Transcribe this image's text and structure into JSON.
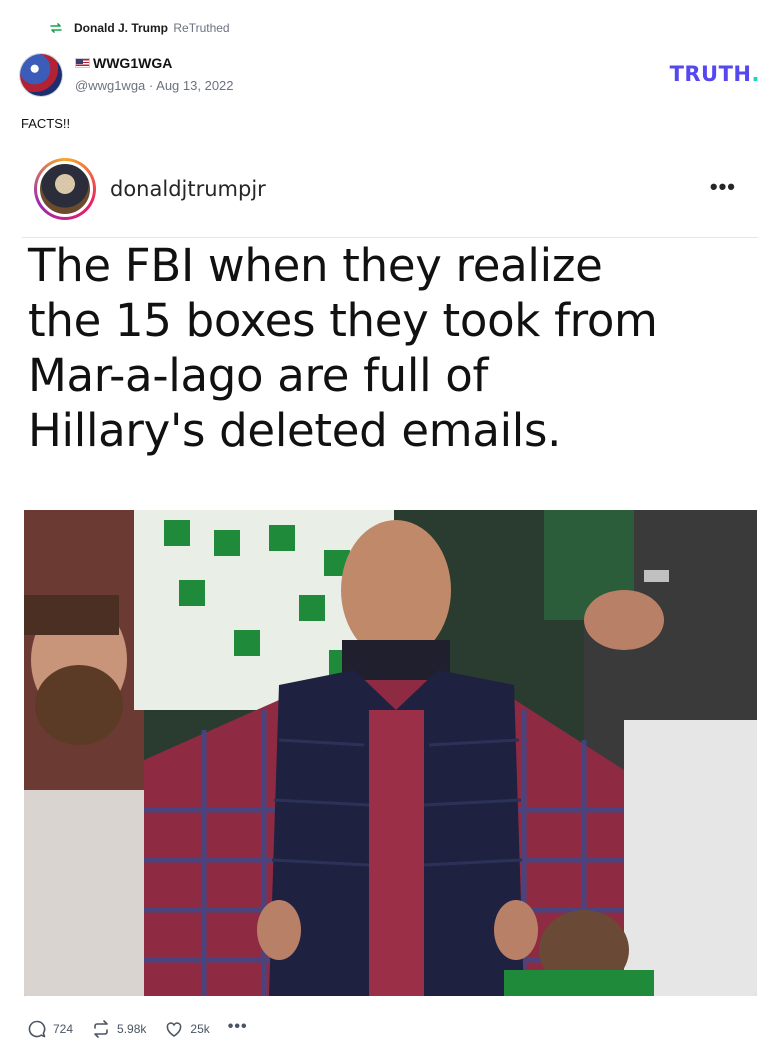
{
  "retruth": {
    "user": "Donald J. Trump",
    "label": "ReTruthed",
    "icon": "retruth-icon"
  },
  "post": {
    "display_name": "WWG1WGA",
    "name_prefix_icon": "us-flag-icon",
    "handle": "@wwg1wga",
    "separator": "·",
    "date": "Aug 13, 2022",
    "text": "FACTS!!"
  },
  "brand": {
    "name": "TRUTH",
    "dot": ".",
    "primary_color": "#5448ee",
    "accent_color": "#19d3c5"
  },
  "media": {
    "username": "donaldjtrumpjr",
    "more_icon": "ellipsis-icon",
    "caption_lines": [
      "The FBI when they realize",
      "the 15 boxes they took from",
      "Mar-a-lago are full of",
      "Hillary's deleted emails."
    ]
  },
  "actions": {
    "replies": "724",
    "retruths": "5.98k",
    "likes": "25k",
    "more": "•••"
  }
}
